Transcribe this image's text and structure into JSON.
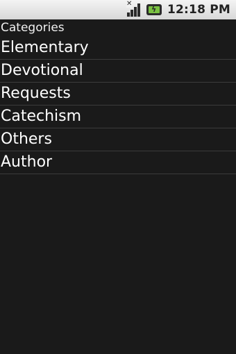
{
  "status_bar": {
    "time": "12:18 PM",
    "icons": [
      "signal-no-data-icon",
      "battery-charging-icon"
    ]
  },
  "header": {
    "title": "Categories"
  },
  "categories": [
    {
      "label": "Elementary"
    },
    {
      "label": "Devotional"
    },
    {
      "label": "Requests"
    },
    {
      "label": "Catechism"
    },
    {
      "label": "Others"
    },
    {
      "label": "Author"
    }
  ],
  "colors": {
    "background": "#1a1a1a",
    "divider": "#3c3c3c",
    "text": "#ffffff",
    "battery": "#7ac142"
  }
}
